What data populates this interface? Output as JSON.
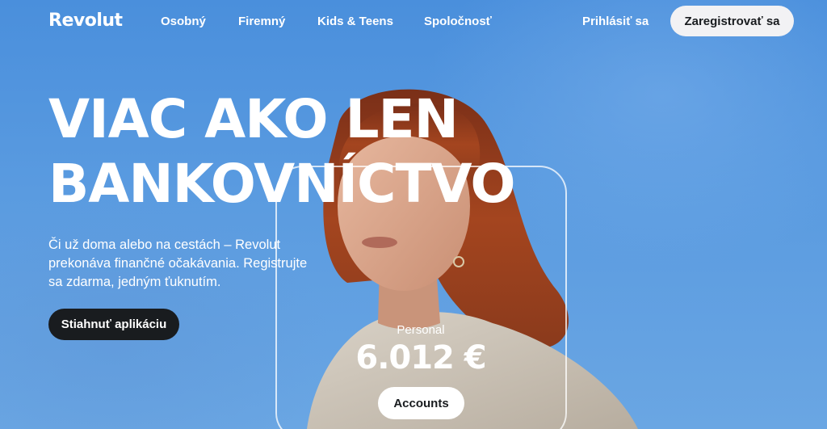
{
  "brand": {
    "logo_text": "Revolut"
  },
  "nav": {
    "links": [
      "Osobný",
      "Firemný",
      "Kids & Teens",
      "Spoločnosť"
    ],
    "login_label": "Prihlásiť sa",
    "signup_label": "Zaregistrovať sa"
  },
  "hero": {
    "headline_line1": "VIAC AKO LEN",
    "headline_line2": "BANKOVNÍCTVO",
    "subtitle": "Či už doma alebo na cestách – Revolut prekonáva finančné očakávania. Registrujte sa zdarma, jedným ťuknutím.",
    "cta_label": "Stiahnuť aplikáciu"
  },
  "account_card": {
    "label": "Personal",
    "balance": "6.012 €",
    "button_label": "Accounts"
  },
  "colors": {
    "sky": "#5a9be0",
    "dark": "#191c1f",
    "light_button": "#f2f2f4",
    "hair": "#9c3f22"
  }
}
